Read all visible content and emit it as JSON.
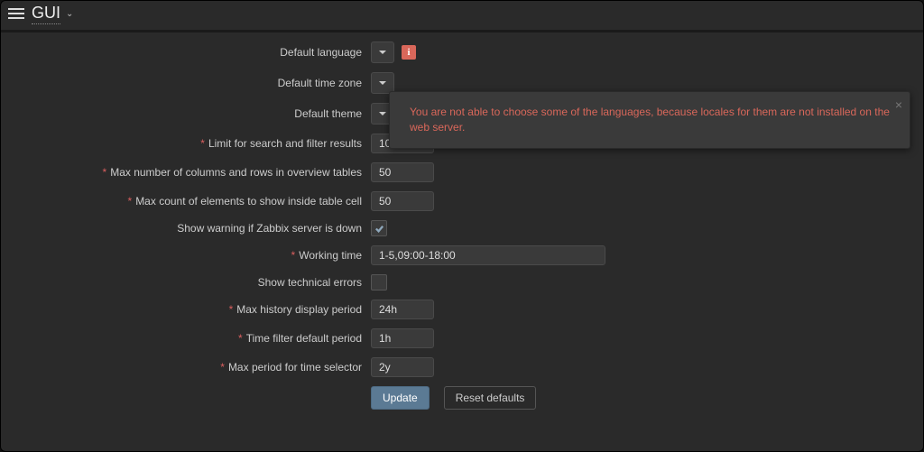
{
  "header": {
    "title": "GUI"
  },
  "popover": {
    "text": "You are not able to choose some of the languages, because locales for them are not installed on the web server."
  },
  "form": {
    "default_language": {
      "label": "Default language",
      "value": ""
    },
    "default_time_zone": {
      "label": "Default time zone",
      "value": ""
    },
    "default_theme": {
      "label": "Default theme",
      "value": ""
    },
    "limit_results": {
      "label": "Limit for search and filter results",
      "required": true,
      "value": "1000"
    },
    "max_columns_rows": {
      "label": "Max number of columns and rows in overview tables",
      "required": true,
      "value": "50"
    },
    "max_cell_elements": {
      "label": "Max count of elements to show inside table cell",
      "required": true,
      "value": "50"
    },
    "show_server_down": {
      "label": "Show warning if Zabbix server is down",
      "checked": true
    },
    "working_time": {
      "label": "Working time",
      "required": true,
      "value": "1-5,09:00-18:00"
    },
    "show_tech_errors": {
      "label": "Show technical errors",
      "checked": false
    },
    "max_history_period": {
      "label": "Max history display period",
      "required": true,
      "value": "24h"
    },
    "time_filter_default": {
      "label": "Time filter default period",
      "required": true,
      "value": "1h"
    },
    "max_period_selector": {
      "label": "Max period for time selector",
      "required": true,
      "value": "2y"
    }
  },
  "buttons": {
    "update": "Update",
    "reset": "Reset defaults"
  }
}
